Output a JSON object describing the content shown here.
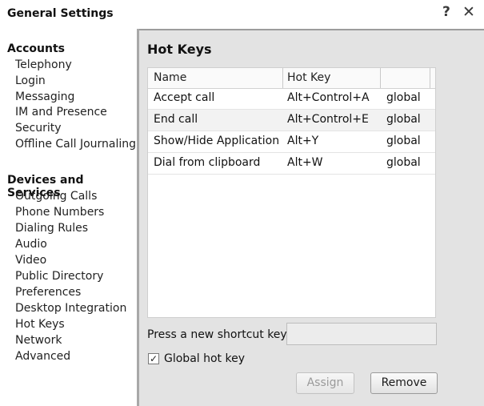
{
  "window": {
    "title": "General Settings",
    "help_label": "?",
    "close_label": "✕"
  },
  "sidebar": {
    "sections": [
      {
        "title": "Accounts",
        "items": [
          "Telephony",
          "Login",
          "Messaging",
          "IM and Presence",
          "Security",
          "Offline Call Journaling"
        ]
      },
      {
        "title": "Devices and Services",
        "items": [
          "Outgoing Calls",
          "Phone Numbers",
          "Dialing Rules",
          "Audio",
          "Video",
          "Public Directory",
          "Preferences",
          "Desktop Integration",
          "Hot Keys",
          "Network",
          "Advanced"
        ]
      }
    ]
  },
  "main": {
    "title": "Hot Keys",
    "table": {
      "headers": [
        "Name",
        "Hot Key",
        ""
      ],
      "rows": [
        {
          "name": "Accept call",
          "hotkey": "Alt+Control+A",
          "scope": "global"
        },
        {
          "name": "End call",
          "hotkey": "Alt+Control+E",
          "scope": "global"
        },
        {
          "name": "Show/Hide Application",
          "hotkey": "Alt+Y",
          "scope": "global"
        },
        {
          "name": "Dial from clipboard",
          "hotkey": "Alt+W",
          "scope": "global"
        }
      ]
    },
    "shortcut_label": "Press a new shortcut key:",
    "shortcut_value": "",
    "global_checkbox": {
      "label": "Global hot key",
      "checked": true
    },
    "assign_label": "Assign",
    "remove_label": "Remove"
  }
}
